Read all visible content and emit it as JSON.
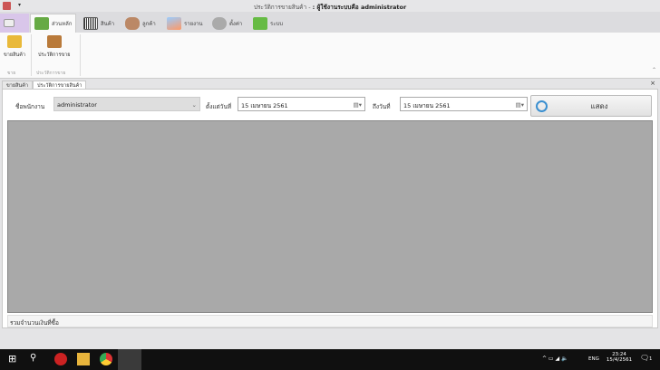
{
  "window": {
    "title_prefix": "ประวัติการขายสินค้า - ",
    "title_user": ": ผู้ใช้งานระบบคือ administrator"
  },
  "ribbon_tabs": [
    {
      "label": ""
    },
    {
      "label": "ส่วนหลัก"
    },
    {
      "label": "สินค้า"
    },
    {
      "label": "ลูกค้า"
    },
    {
      "label": "รายงาน"
    },
    {
      "label": "ตั้งค่า"
    },
    {
      "label": "ระบบ"
    }
  ],
  "ribbon": {
    "buttons": [
      {
        "label": "ขายสินค้า"
      },
      {
        "label": "ประวัติการขาย"
      }
    ],
    "groups": [
      {
        "label": "ขาย"
      },
      {
        "label": "ประวัติการขาย"
      }
    ]
  },
  "doc_tabs": [
    {
      "label": "ขายสินค้า"
    },
    {
      "label": "ประวัติการขายสินค้า"
    }
  ],
  "filter": {
    "employee_label": "ชื่อพนักงาน",
    "employee_value": "administrator",
    "from_label": "ตั้งแต่วันที่",
    "from_date": "15   เมษายน     2561",
    "to_label": "ถึงวันที่",
    "to_date": "15   เมษายน     2561",
    "show_button": "แสดง"
  },
  "footer": {
    "total_label": "รวมจำนวนเงินที่ซื้อ"
  },
  "taskbar": {
    "lang": "ENG",
    "time": "23:24",
    "date": "15/4/2561",
    "notif_count": "1"
  }
}
